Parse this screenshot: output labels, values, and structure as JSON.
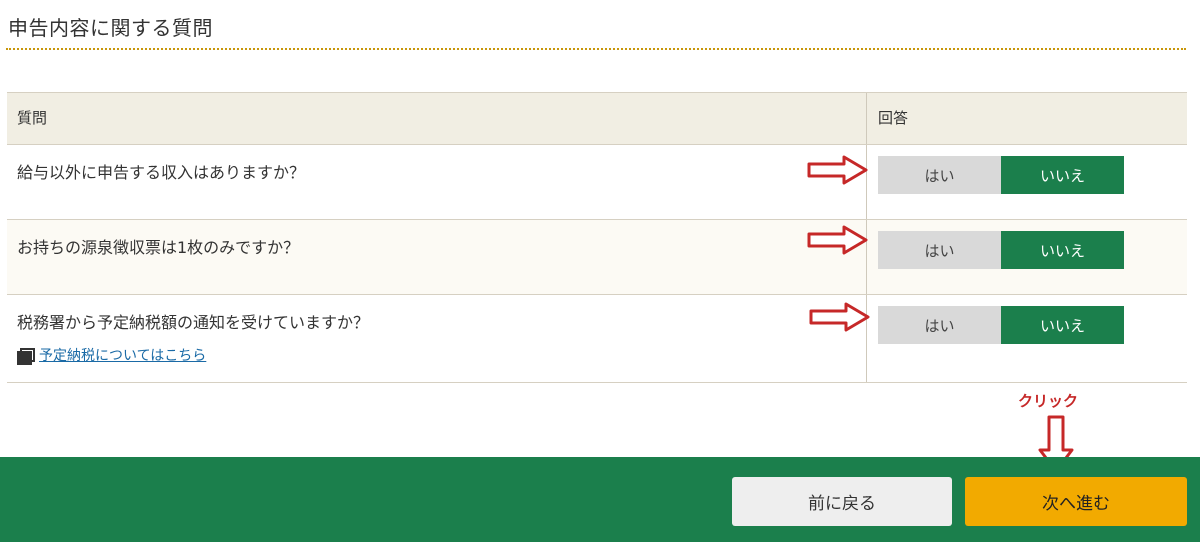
{
  "section": {
    "title": "申告内容に関する質問"
  },
  "table": {
    "header_question": "質問",
    "header_answer": "回答",
    "rows": [
      {
        "question": "給与以外に申告する収入はありますか？",
        "yes_label": "はい",
        "no_label": "いいえ",
        "selected": "いいえ"
      },
      {
        "question": "お持ちの源泉徴収票は1枚のみですか？",
        "yes_label": "はい",
        "no_label": "いいえ",
        "selected": "いいえ"
      },
      {
        "question": "税務署から予定納税額の通知を受けていますか？",
        "yes_label": "はい",
        "no_label": "いいえ",
        "selected": "いいえ",
        "link_text": "予定納税についてはこちら",
        "link_icon": "external-window-icon"
      }
    ]
  },
  "annotation": {
    "click_label": "クリック"
  },
  "footer": {
    "back_label": "前に戻る",
    "next_label": "次へ進む"
  },
  "colors": {
    "selected_green": "#1b7f4c",
    "unselected_gray": "#d9d9d9",
    "next_button": "#f2aa00",
    "annotation_red": "#c62828",
    "header_beige": "#f1eee3"
  }
}
